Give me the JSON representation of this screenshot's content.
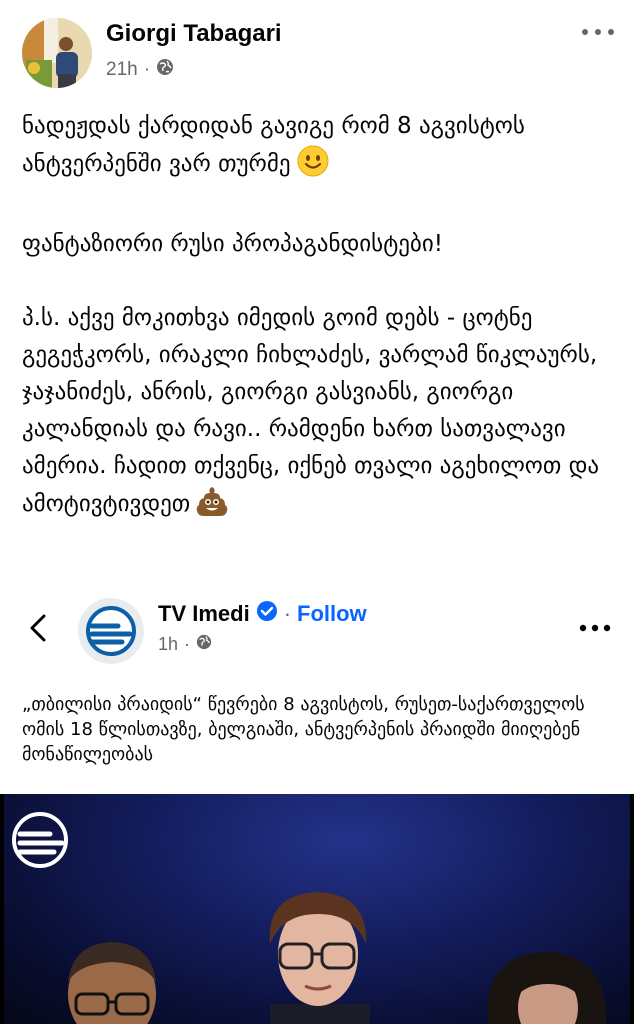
{
  "post": {
    "author": "Giorgi Tabagari",
    "time": "21h",
    "visibility_icon": "globe-icon",
    "paragraphs": [
      "ნადეჟდას ქარდიდან გავიგე რომ 8 აგვისტოს ანტვერპენში ვარ თურმე",
      "ფანტაზიორი რუსი პროპაგანდისტები!",
      "პ.ს. აქვე მოკითხვა იმედის გოიმ დებს - ცოტნე გეგეჭკორს, ირაკლი ჩიხლაძეს, ვარლამ წიკლაურს, ჯაჯანიძეს, ანრის, გიორგი გასვიანს, გიორგი კალანდიას და რავი.. რამდენი ხართ სათვალავი ამერია. ჩადით თქვენც, იქნებ თვალი აგეხილოთ და ამოტივტივდეთ"
    ],
    "emoji_1": "slightly-smiling-face",
    "emoji_2": "pile-of-poo"
  },
  "shared": {
    "page_name": "TV Imedi",
    "separator": "·",
    "follow_label": "Follow",
    "time": "1h",
    "text": "„თბილისი პრაიდის“ წევრები 8 აგვისტოს, რუსეთ-საქართველოს ომის 18 წლისთავზე, ბელგიაში, ანტვერპენის პრაიდში მიიღებენ მონაწილეობას",
    "verified_badge_color": "#0866ff",
    "image_background": "#141d5e"
  }
}
